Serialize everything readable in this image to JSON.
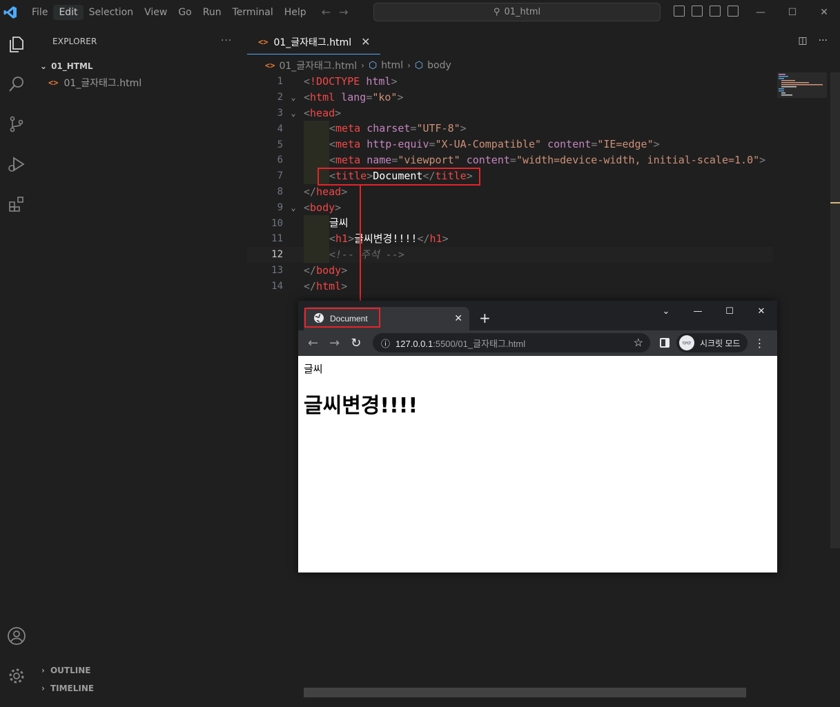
{
  "titlebar": {
    "menu": [
      "File",
      "Edit",
      "Selection",
      "View",
      "Go",
      "Run",
      "Terminal",
      "Help"
    ],
    "active_menu": "Edit",
    "search_text": "01_html"
  },
  "sidebar": {
    "header": "EXPLORER",
    "folder": "01_HTML",
    "file": "01_글자태그.html",
    "outline": "OUTLINE",
    "timeline": "TIMELINE"
  },
  "editor": {
    "tab_label": "01_글자태그.html",
    "breadcrumb": [
      "01_글자태그.html",
      "html",
      "body"
    ],
    "current_line": 12,
    "lines": [
      {
        "n": "1",
        "fold": ""
      },
      {
        "n": "2",
        "fold": "⌄"
      },
      {
        "n": "3",
        "fold": "⌄"
      },
      {
        "n": "4",
        "fold": ""
      },
      {
        "n": "5",
        "fold": ""
      },
      {
        "n": "6",
        "fold": ""
      },
      {
        "n": "7",
        "fold": ""
      },
      {
        "n": "8",
        "fold": ""
      },
      {
        "n": "9",
        "fold": "⌄"
      },
      {
        "n": "10",
        "fold": ""
      },
      {
        "n": "11",
        "fold": ""
      },
      {
        "n": "12",
        "fold": ""
      },
      {
        "n": "13",
        "fold": ""
      },
      {
        "n": "14",
        "fold": ""
      }
    ],
    "code": {
      "doctype": "!DOCTYPE",
      "html_kw": "html",
      "html_tag": "html",
      "lang_attr": "lang",
      "lang_val": "\"ko\"",
      "head_tag": "head",
      "meta_tag": "meta",
      "charset_attr": "charset",
      "charset_val": "\"UTF-8\"",
      "httpequiv_attr": "http-equiv",
      "httpequiv_val": "\"X-UA-Compatible\"",
      "content_attr": "content",
      "content_val1": "\"IE=edge\"",
      "name_attr": "name",
      "name_val": "\"viewport\"",
      "content_val2": "\"width=device-width, initial-scale=1.0\"",
      "title_tag": "title",
      "title_text": "Document",
      "body_tag": "body",
      "body_text": "글씨",
      "h1_tag": "h1",
      "h1_text": "글씨변경!!!!",
      "comment": "<!-- 주석 -->"
    }
  },
  "browser": {
    "tab_title": "Document",
    "url_host": "127.0.0.1",
    "url_rest": ":5500/01_글자태그.html",
    "incognito_label": "시크릿 모드",
    "page_text": "글씨",
    "page_h1": "글씨변경!!!!"
  },
  "colors": {
    "accent": "#4daafc",
    "highlight": "#e5252a"
  }
}
